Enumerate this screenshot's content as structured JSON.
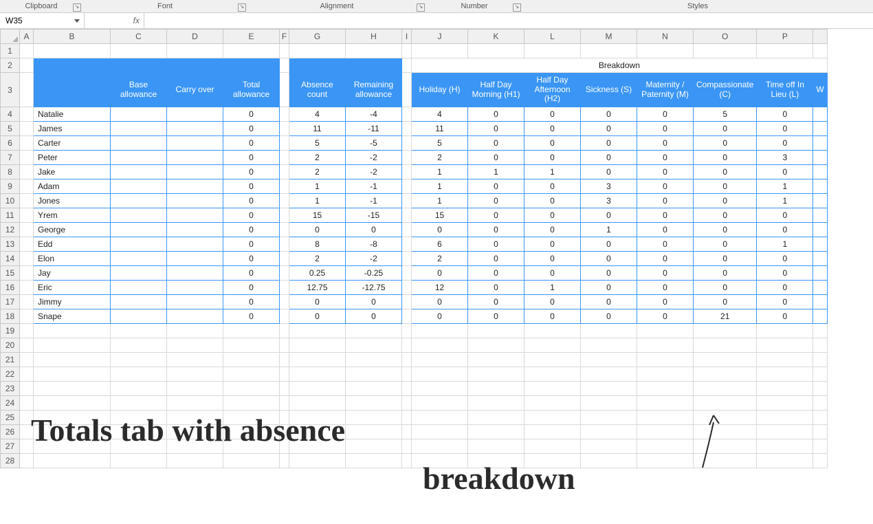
{
  "ribbon": {
    "groups": [
      "Clipboard",
      "Font",
      "Alignment",
      "Number",
      "Styles"
    ]
  },
  "namebox": {
    "value": "W35"
  },
  "fx_label": "fx",
  "formula": "",
  "columns": [
    "A",
    "B",
    "C",
    "D",
    "E",
    "F",
    "G",
    "H",
    "I",
    "J",
    "K",
    "L",
    "M",
    "N",
    "O",
    "P",
    ""
  ],
  "rows": [
    "1",
    "2",
    "3",
    "4",
    "5",
    "6",
    "7",
    "8",
    "9",
    "10",
    "11",
    "12",
    "13",
    "14",
    "15",
    "16",
    "17",
    "18",
    "19",
    "20",
    "21",
    "22",
    "23",
    "24",
    "25",
    "26",
    "27",
    "28"
  ],
  "breakdown_label": "Breakdown",
  "headers": {
    "name": "",
    "base": "Base allowance",
    "carry": "Carry over",
    "total": "Total allowance",
    "absence": "Absence count",
    "remaining": "Remaining allowance",
    "holiday": "Holiday (H)",
    "hdm": "Half Day Morning (H1)",
    "hda": "Half Day Afternoon (H2)",
    "sick": "Sickness (S)",
    "mat": "Maternity / Paternity (M)",
    "comp": "Compassionate (C)",
    "lieu": "Time off In Lieu (L)",
    "wfh": "W"
  },
  "data": [
    {
      "name": "Natalie",
      "base": "",
      "carry": "",
      "total": "0",
      "abs": "4",
      "rem": "-4",
      "h": "4",
      "h1": "0",
      "h2": "0",
      "s": "0",
      "m": "0",
      "c": "5",
      "l": "0"
    },
    {
      "name": "James",
      "base": "",
      "carry": "",
      "total": "0",
      "abs": "11",
      "rem": "-11",
      "h": "11",
      "h1": "0",
      "h2": "0",
      "s": "0",
      "m": "0",
      "c": "0",
      "l": "0"
    },
    {
      "name": "Carter",
      "base": "",
      "carry": "",
      "total": "0",
      "abs": "5",
      "rem": "-5",
      "h": "5",
      "h1": "0",
      "h2": "0",
      "s": "0",
      "m": "0",
      "c": "0",
      "l": "0"
    },
    {
      "name": "Peter",
      "base": "",
      "carry": "",
      "total": "0",
      "abs": "2",
      "rem": "-2",
      "h": "2",
      "h1": "0",
      "h2": "0",
      "s": "0",
      "m": "0",
      "c": "0",
      "l": "3"
    },
    {
      "name": "Jake",
      "base": "",
      "carry": "",
      "total": "0",
      "abs": "2",
      "rem": "-2",
      "h": "1",
      "h1": "1",
      "h2": "1",
      "s": "0",
      "m": "0",
      "c": "0",
      "l": "0"
    },
    {
      "name": "Adam",
      "base": "",
      "carry": "",
      "total": "0",
      "abs": "1",
      "rem": "-1",
      "h": "1",
      "h1": "0",
      "h2": "0",
      "s": "3",
      "m": "0",
      "c": "0",
      "l": "1"
    },
    {
      "name": "Jones",
      "base": "",
      "carry": "",
      "total": "0",
      "abs": "1",
      "rem": "-1",
      "h": "1",
      "h1": "0",
      "h2": "0",
      "s": "3",
      "m": "0",
      "c": "0",
      "l": "1"
    },
    {
      "name": "Yrem",
      "base": "",
      "carry": "",
      "total": "0",
      "abs": "15",
      "rem": "-15",
      "h": "15",
      "h1": "0",
      "h2": "0",
      "s": "0",
      "m": "0",
      "c": "0",
      "l": "0"
    },
    {
      "name": "George",
      "base": "",
      "carry": "",
      "total": "0",
      "abs": "0",
      "rem": "0",
      "h": "0",
      "h1": "0",
      "h2": "0",
      "s": "1",
      "m": "0",
      "c": "0",
      "l": "0"
    },
    {
      "name": "Edd",
      "base": "",
      "carry": "",
      "total": "0",
      "abs": "8",
      "rem": "-8",
      "h": "6",
      "h1": "0",
      "h2": "0",
      "s": "0",
      "m": "0",
      "c": "0",
      "l": "1"
    },
    {
      "name": "Elon",
      "base": "",
      "carry": "",
      "total": "0",
      "abs": "2",
      "rem": "-2",
      "h": "2",
      "h1": "0",
      "h2": "0",
      "s": "0",
      "m": "0",
      "c": "0",
      "l": "0"
    },
    {
      "name": "Jay",
      "base": "",
      "carry": "",
      "total": "0",
      "abs": "0.25",
      "rem": "-0.25",
      "h": "0",
      "h1": "0",
      "h2": "0",
      "s": "0",
      "m": "0",
      "c": "0",
      "l": "0"
    },
    {
      "name": "Eric",
      "base": "",
      "carry": "",
      "total": "0",
      "abs": "12.75",
      "rem": "-12.75",
      "h": "12",
      "h1": "0",
      "h2": "1",
      "s": "0",
      "m": "0",
      "c": "0",
      "l": "0"
    },
    {
      "name": "Jimmy",
      "base": "",
      "carry": "",
      "total": "0",
      "abs": "0",
      "rem": "0",
      "h": "0",
      "h1": "0",
      "h2": "0",
      "s": "0",
      "m": "0",
      "c": "0",
      "l": "0"
    },
    {
      "name": "Snape",
      "base": "",
      "carry": "",
      "total": "0",
      "abs": "0",
      "rem": "0",
      "h": "0",
      "h1": "0",
      "h2": "0",
      "s": "0",
      "m": "0",
      "c": "21",
      "l": "0"
    }
  ],
  "annotation": {
    "line1": "Totals tab with absence",
    "line2": "breakdown"
  }
}
